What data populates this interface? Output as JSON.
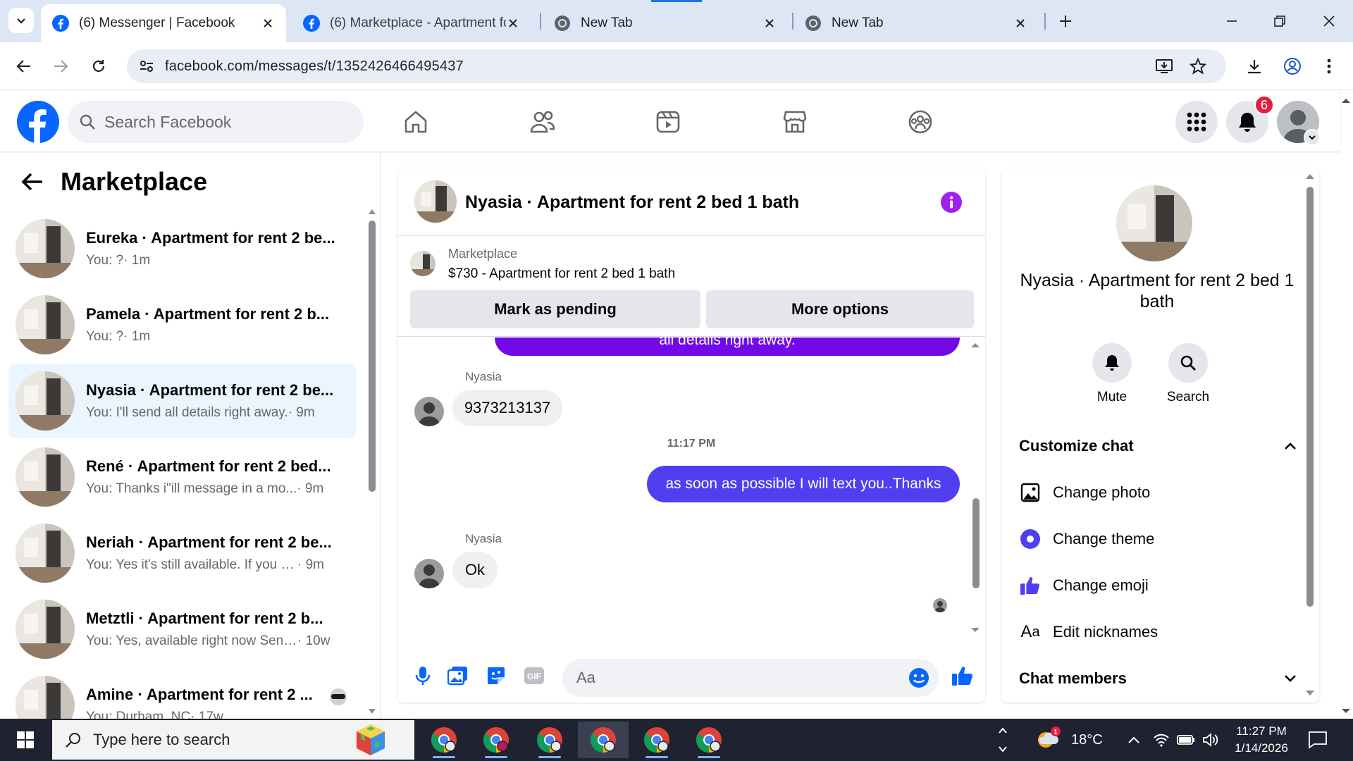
{
  "browser": {
    "tabs": [
      {
        "title": "(6) Messenger | Facebook",
        "active": true
      },
      {
        "title": "(6) Marketplace - Apartment for",
        "active": false
      },
      {
        "title": "New Tab",
        "active": false
      },
      {
        "title": "New Tab",
        "active": false
      }
    ],
    "url": "facebook.com/messages/t/1352426466495437"
  },
  "facebook": {
    "search_placeholder": "Search Facebook",
    "notification_count": "6"
  },
  "sidebar": {
    "title": "Marketplace",
    "conversations": [
      {
        "name": "Eureka · Apartment for rent 2 be...",
        "preview": "You: ?",
        "time": " · 1m"
      },
      {
        "name": "Pamela · Apartment for rent 2 b...",
        "preview": "You: ?",
        "time": " · 1m"
      },
      {
        "name": "Nyasia · Apartment for rent 2 be...",
        "preview": "You: I'll send all details right away.",
        "time": " · 9m",
        "selected": true
      },
      {
        "name": "René · Apartment for rent 2 bed...",
        "preview": "You: Thanks i\"ill message in a mo...",
        "time": " · 9m"
      },
      {
        "name": "Neriah · Apartment for rent 2 be...",
        "preview": "You: Yes it's still available. If you ca...",
        "time": " · 9m"
      },
      {
        "name": "Metztli · Apartment for rent 2 b...",
        "preview": "You: Yes, available right now Send...",
        "time": " · 10w"
      },
      {
        "name": "Amine · Apartment for rent 2 ...",
        "preview": "You: Durham, NC",
        "time": " · 17w"
      }
    ]
  },
  "chat": {
    "title": "Nyasia · Apartment for rent 2 bed 1 bath",
    "marketplace_label": "Marketplace",
    "listing": "$730 - Apartment for rent 2 bed 1 bath",
    "mark_pending": "Mark as pending",
    "more_options": "More options",
    "messages": {
      "partial_out": "all details right away.",
      "sender1": "Nyasia",
      "in1": "9373213137",
      "timestamp": "11:17 PM",
      "out1": "as soon as possible I will text you..Thanks",
      "sender2": "Nyasia",
      "in2": "Ok"
    },
    "composer_placeholder": "Aa",
    "colors": {
      "accent": "#7209e6",
      "bubble_out": "#4f3ff0"
    }
  },
  "info_panel": {
    "name": "Nyasia · Apartment for rent 2 bed 1 bath",
    "mute": "Mute",
    "search": "Search",
    "customize_chat": "Customize chat",
    "options": [
      "Change photo",
      "Change theme",
      "Change emoji",
      "Edit nicknames"
    ],
    "chat_members": "Chat members"
  },
  "taskbar": {
    "search_placeholder": "Type here to search",
    "weather": "18°C",
    "weather_badge": "1",
    "time": "11:27 PM",
    "date": "1/14/2026"
  }
}
